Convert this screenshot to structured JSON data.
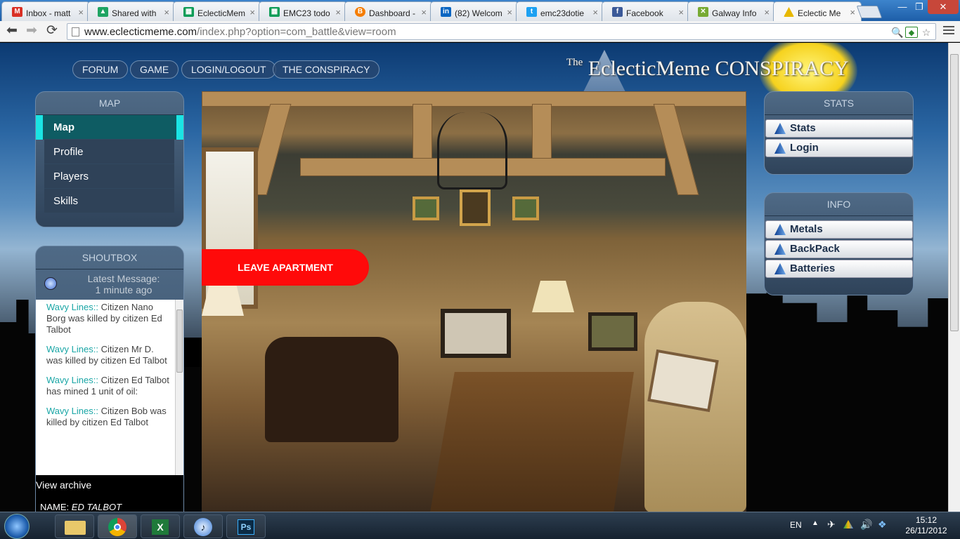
{
  "browser": {
    "tabs": [
      {
        "title": "Inbox - matt",
        "icon": "gmail-icon",
        "color": "#d93025"
      },
      {
        "title": "Shared with",
        "icon": "drive-icon",
        "color": "#1fa463"
      },
      {
        "title": "EclecticMem",
        "icon": "sheets-icon",
        "color": "#0f9d58"
      },
      {
        "title": "EMC23 todo",
        "icon": "sheets-icon",
        "color": "#0f9d58"
      },
      {
        "title": "Dashboard -",
        "icon": "blogger-icon",
        "color": "#f57d00"
      },
      {
        "title": "(82) Welcom",
        "icon": "linkedin-icon",
        "color": "#0a66c2"
      },
      {
        "title": "emc23dotie",
        "icon": "twitter-icon",
        "color": "#1da1f2"
      },
      {
        "title": "Facebook",
        "icon": "facebook-icon",
        "color": "#3b5998"
      },
      {
        "title": "Galway Info",
        "icon": "galway-icon",
        "color": "#7a3"
      },
      {
        "title": "Eclectic Me",
        "icon": "eclectic-icon",
        "color": "#e8b800"
      }
    ],
    "url_host": "www.eclecticmeme.com",
    "url_path": "/index.php?option=com_battle&view=room"
  },
  "site": {
    "nav": [
      "FORUM",
      "GAME",
      "LOGIN/LOGOUT",
      "THE CONSPIRACY"
    ],
    "logo_the": "The",
    "logo_text": "EclecticMeme CONSPIRACY"
  },
  "map_panel": {
    "title": "MAP",
    "items": [
      "Map",
      "Profile",
      "Players",
      "Skills"
    ],
    "active": "Map"
  },
  "shoutbox": {
    "title": "SHOUTBOX",
    "latest_label": "Latest Message:",
    "latest_time": "1 minute ago",
    "messages": [
      {
        "who": "Wavy Lines::",
        "text": "Citizen Nano Borg was killed by citizen Ed Talbot"
      },
      {
        "who": "Wavy Lines::",
        "text": "Citizen Mr D. was killed by citizen Ed Talbot"
      },
      {
        "who": "Wavy Lines::",
        "text": "Citizen Ed Talbot has mined 1 unit of oil:"
      },
      {
        "who": "Wavy Lines::",
        "text": "Citizen Bob was killed by citizen Ed Talbot"
      }
    ],
    "archive_link": "View archive",
    "name_label": "NAME:",
    "name_value": "ED TALBOT"
  },
  "room": {
    "leave_button": "LEAVE APARTMENT"
  },
  "stats_panel": {
    "title": "STATS",
    "items": [
      "Stats",
      "Login"
    ]
  },
  "info_panel": {
    "title": "INFO",
    "items": [
      "Metals",
      "BackPack",
      "Batteries"
    ]
  },
  "taskbar": {
    "apps": [
      "windows-start-icon",
      "explorer-icon",
      "chrome-icon",
      "excel-icon",
      "itunes-icon",
      "photoshop-icon"
    ],
    "lang": "EN",
    "time": "15:12",
    "date": "26/11/2012"
  }
}
